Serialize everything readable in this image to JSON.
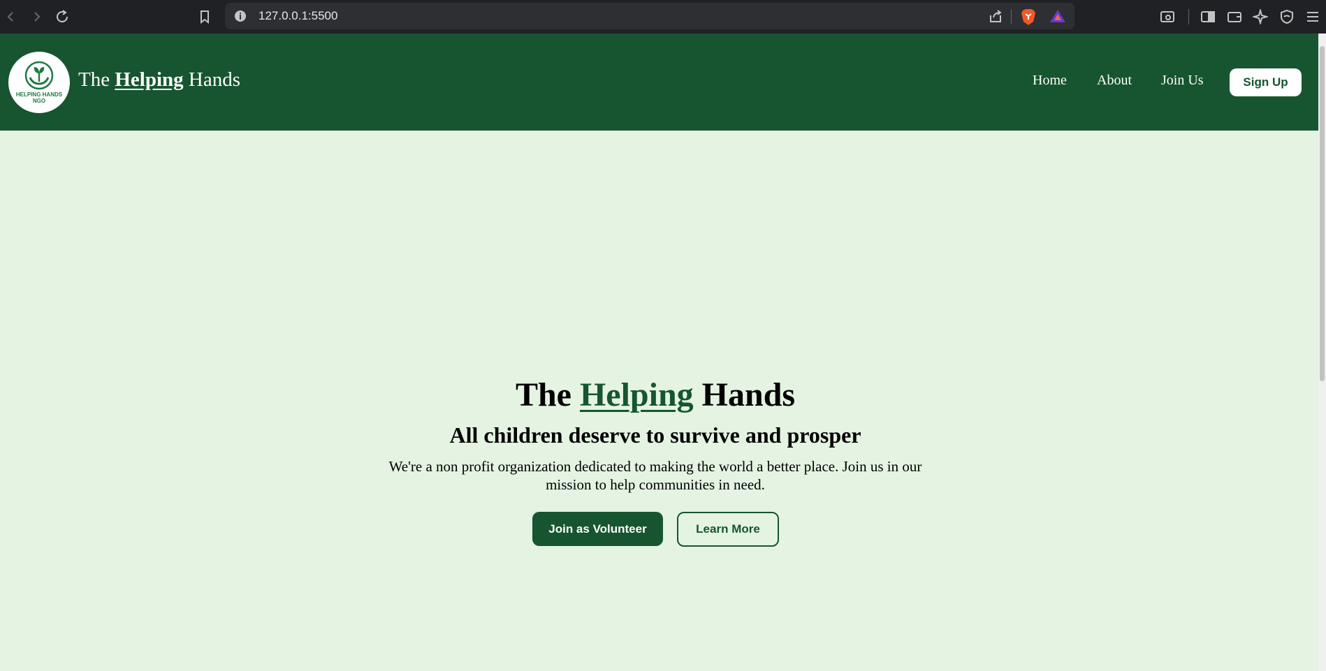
{
  "browser": {
    "url": "127.0.0.1:5500"
  },
  "header": {
    "logo_caption_line1": "HELPING HANDS",
    "logo_caption_line2": "NGO",
    "brand_prefix": "The ",
    "brand_highlight": "Helping",
    "brand_suffix": " Hands",
    "nav": {
      "home": "Home",
      "about": "About",
      "join": "Join Us"
    },
    "signup_label": "Sign Up"
  },
  "hero": {
    "title_prefix": "The ",
    "title_highlight": "Helping",
    "title_suffix": " Hands",
    "subtitle": "All children deserve to survive and prosper",
    "description": "We're a non profit organization dedicated to making the world a better place. Join us in our mission to help communities in need.",
    "primary_button": "Join as Volunteer",
    "secondary_button": "Learn More"
  },
  "colors": {
    "brand_green": "#165530",
    "page_background": "#e4f3e2",
    "chrome_dark": "#202124"
  }
}
